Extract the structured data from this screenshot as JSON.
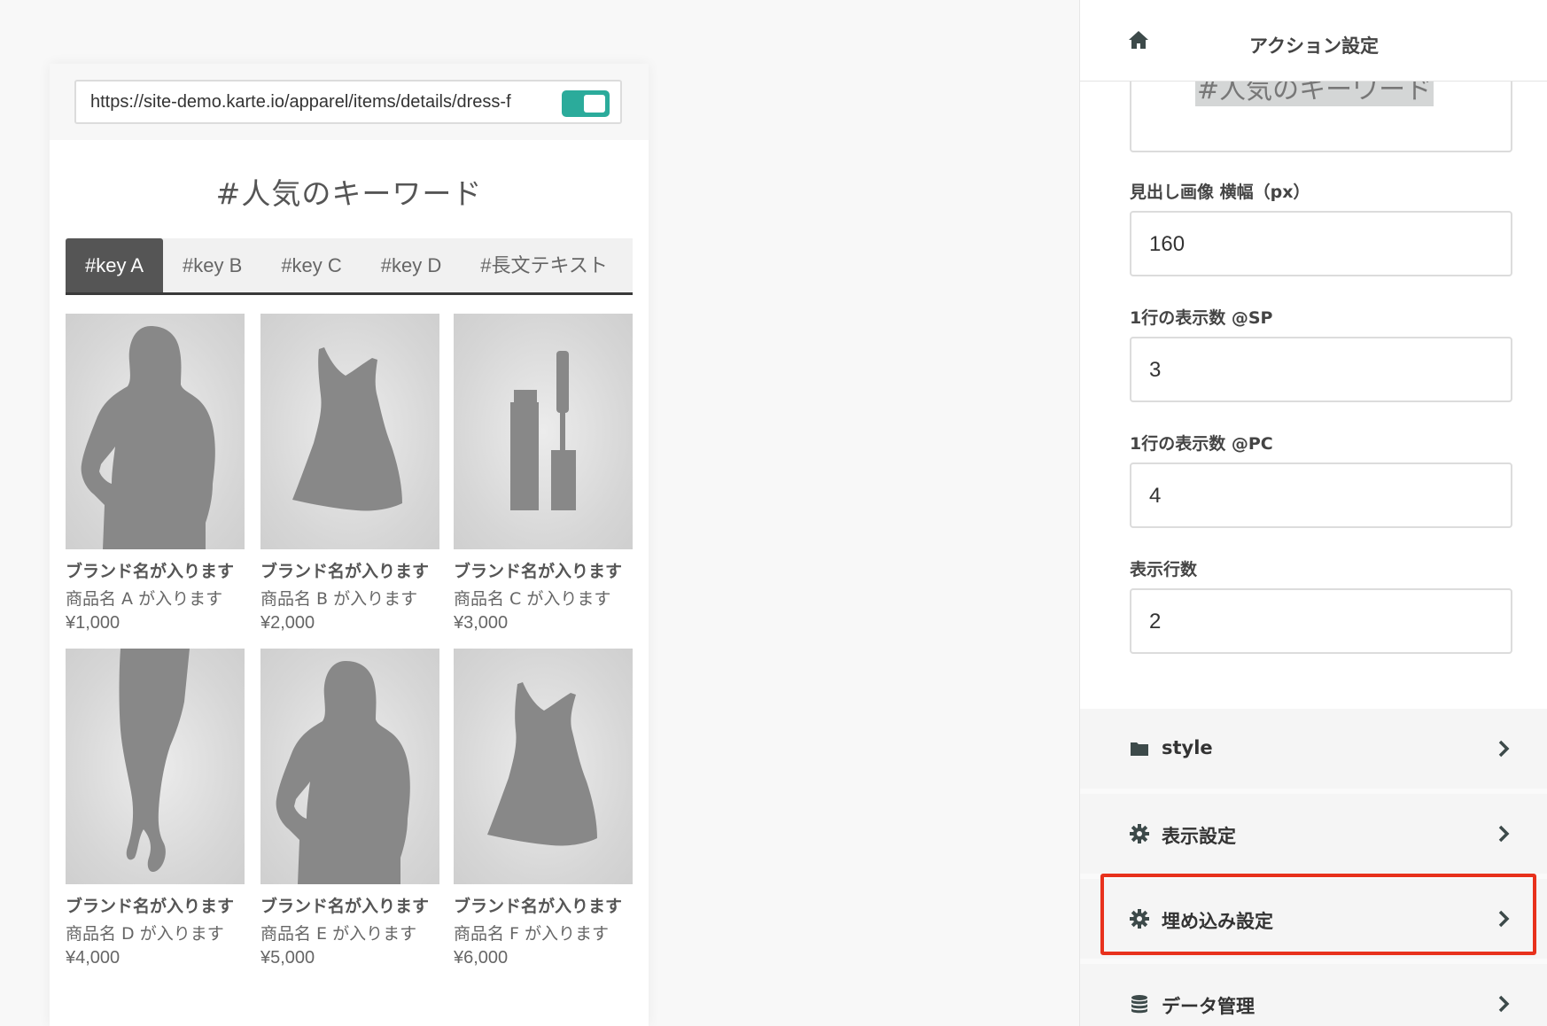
{
  "preview": {
    "url_value": "https://site-demo.karte.io/apparel/items/details/dress-f",
    "toggle_on": true,
    "section_title": "#人気のキーワード",
    "tabs": [
      {
        "label": "#key A",
        "active": true
      },
      {
        "label": "#key B",
        "active": false
      },
      {
        "label": "#key C",
        "active": false
      },
      {
        "label": "#key D",
        "active": false
      },
      {
        "label": "#長文テキスト",
        "active": false
      }
    ],
    "products": [
      {
        "image_icon": "woman-silhouette-icon",
        "brand": "ブランド名が入ります",
        "name": "商品名 A が入ります",
        "price": "¥1,000"
      },
      {
        "image_icon": "dress-silhouette-icon",
        "brand": "ブランド名が入ります",
        "name": "商品名 B が入ります",
        "price": "¥2,000"
      },
      {
        "image_icon": "mascara-icon",
        "brand": "ブランド名が入ります",
        "name": "商品名 C が入ります",
        "price": "¥3,000"
      },
      {
        "image_icon": "legs-silhouette-icon",
        "brand": "ブランド名が入ります",
        "name": "商品名 D が入ります",
        "price": "¥4,000"
      },
      {
        "image_icon": "woman-silhouette-icon",
        "brand": "ブランド名が入ります",
        "name": "商品名 E が入ります",
        "price": "¥5,000"
      },
      {
        "image_icon": "dress-silhouette-icon",
        "brand": "ブランド名が入ります",
        "name": "商品名 F が入ります",
        "price": "¥6,000"
      }
    ]
  },
  "panel": {
    "title": "アクション設定",
    "home_icon": "home-icon",
    "textarea_partial": "#人気のキーワード",
    "fields": [
      {
        "label": "見出し画像 横幅（px）",
        "value": "160"
      },
      {
        "label": "1行の表示数 @SP",
        "value": "3"
      },
      {
        "label": "1行の表示数 @PC",
        "value": "4"
      },
      {
        "label": "表示行数",
        "value": "2"
      }
    ],
    "menu": [
      {
        "label": "style",
        "icon": "folder-icon"
      },
      {
        "label": "表示設定",
        "icon": "gear-icon"
      },
      {
        "label": "埋め込み設定",
        "icon": "gear-icon",
        "highlighted": true
      },
      {
        "label": "データ管理",
        "icon": "database-icon"
      }
    ]
  },
  "colors": {
    "toggle": "#2bab9b",
    "active_tab": "#555555",
    "highlight_border": "#e8311c",
    "silhouette": "#888888"
  }
}
